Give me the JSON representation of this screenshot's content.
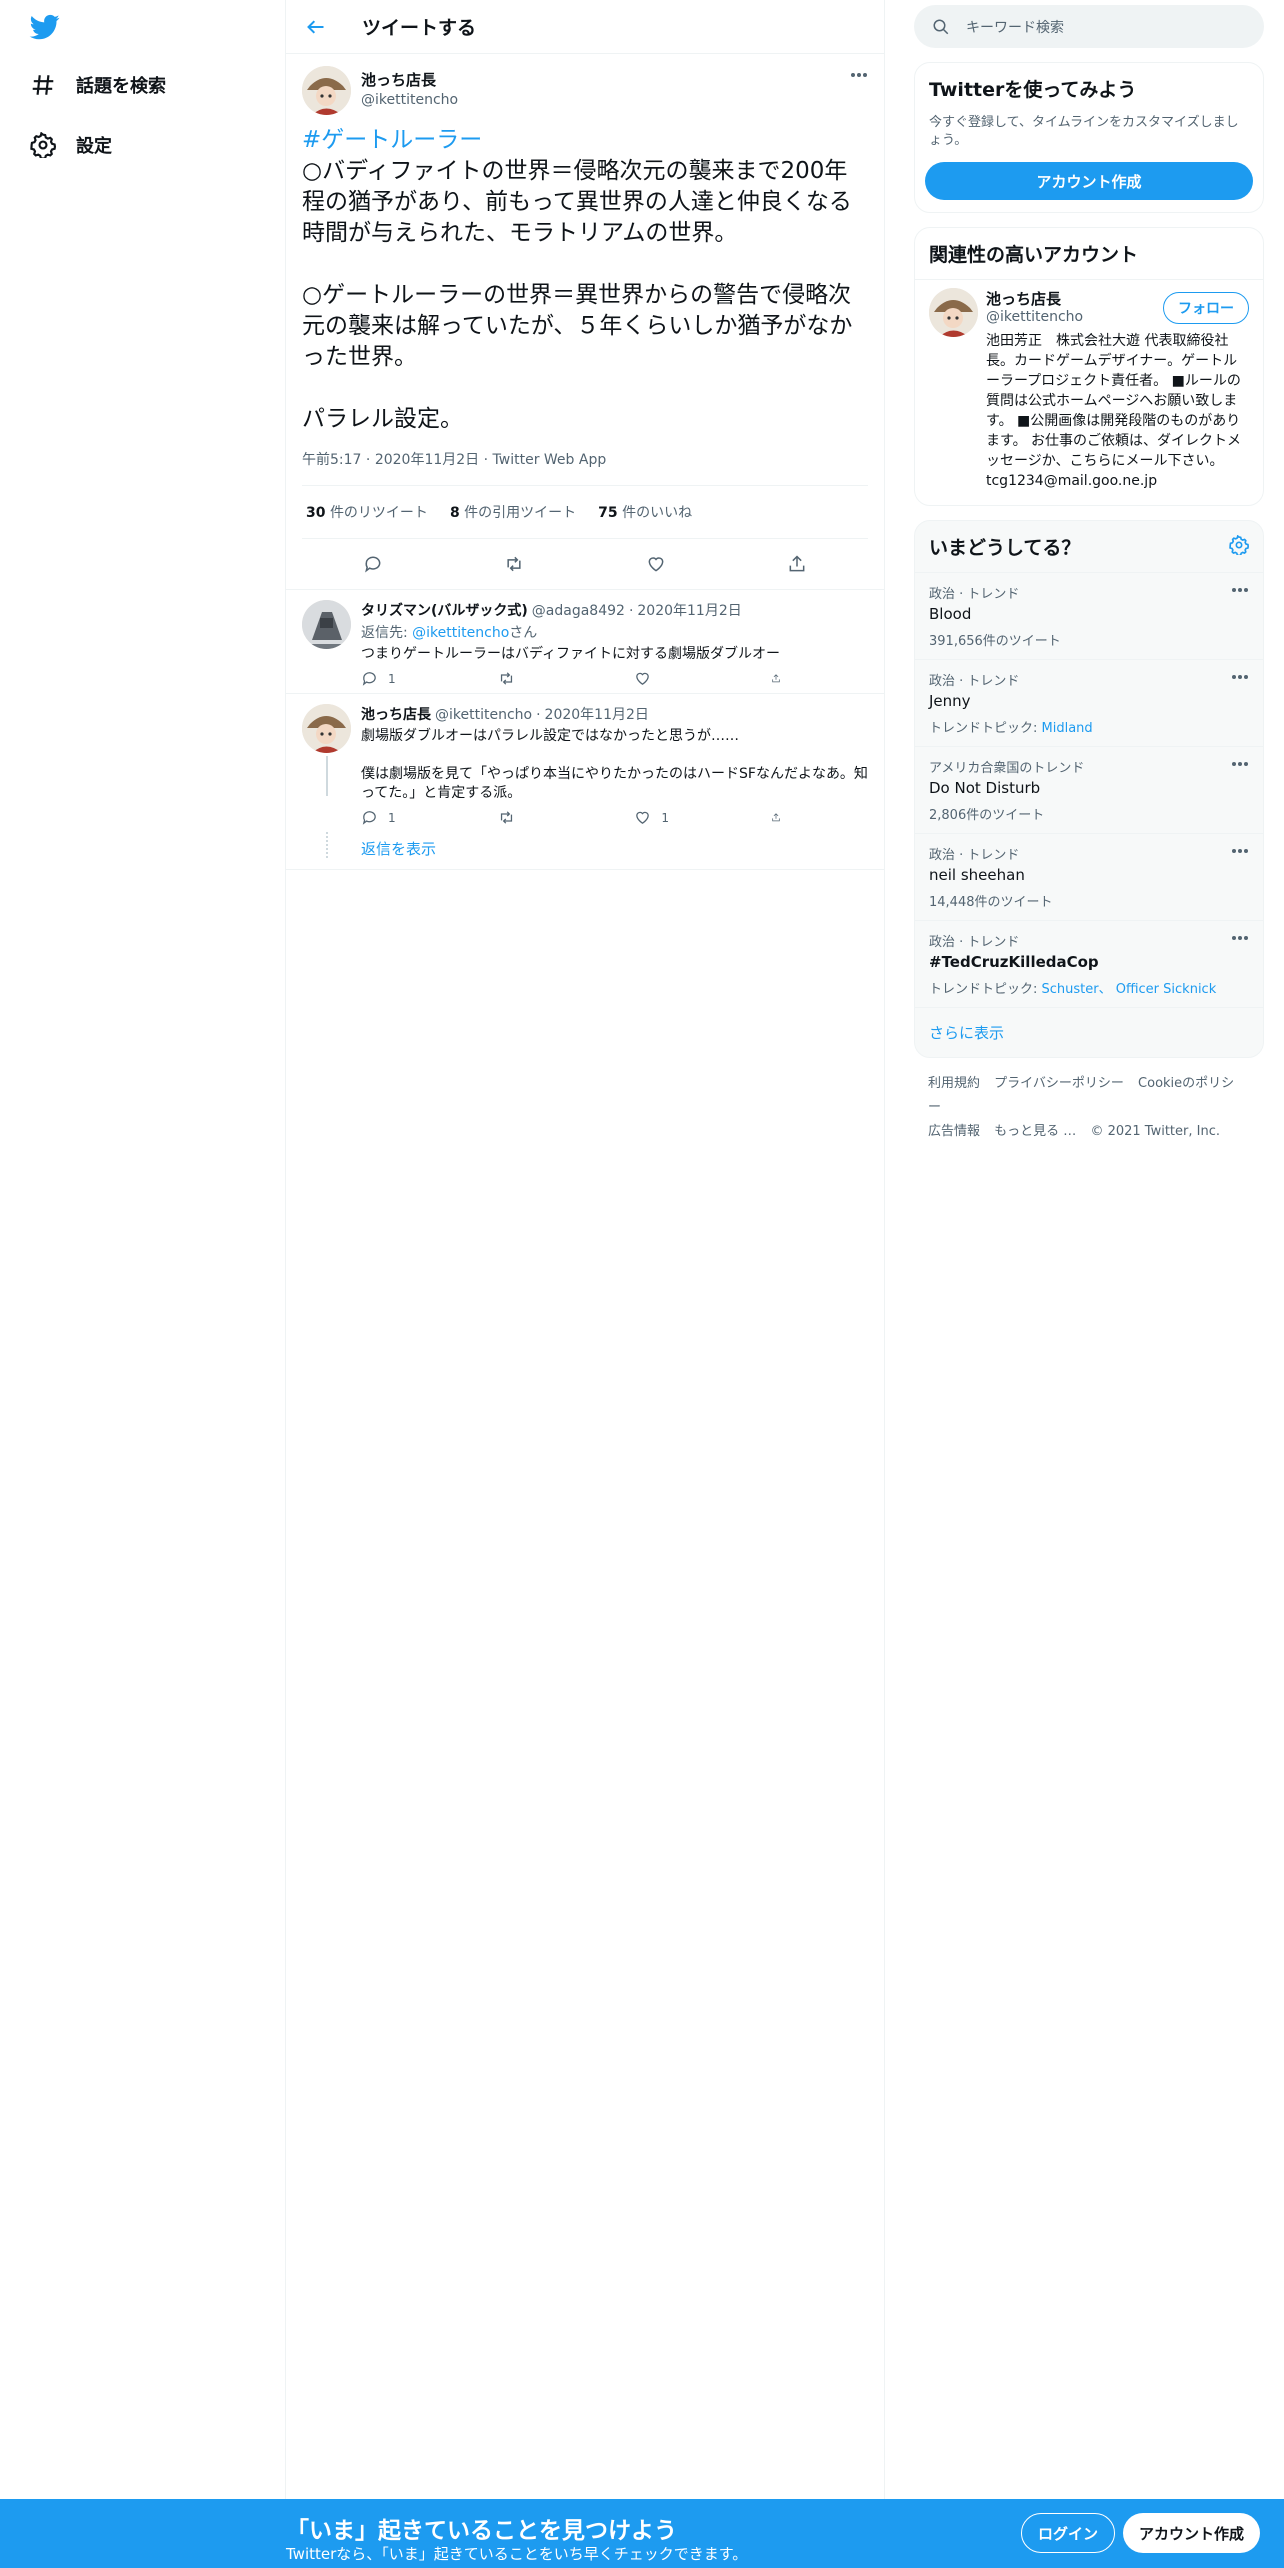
{
  "nav": {
    "items": [
      {
        "label": "話題を検索",
        "icon": "hashtag-icon"
      },
      {
        "label": "設定",
        "icon": "gear-icon"
      }
    ]
  },
  "header": {
    "title": "ツイートする"
  },
  "tweet": {
    "author": {
      "name": "池っち店長",
      "handle": "@ikettitencho"
    },
    "hashtag": "#ゲートルーラー",
    "body": "○バディファイトの世界＝侵略次元の襲来まで200年程の猶予があり、前もって異世界の人達と仲良くなる時間が与えられた、モラトリアムの世界。\n\n○ゲートルーラーの世界＝異世界からの警告で侵略次元の襲来は解っていたが、５年くらいしか猶予がなかった世界。\n\nパラレル設定。",
    "time": "午前5:17",
    "date": "2020年11月2日",
    "source": "Twitter Web App",
    "stats": [
      {
        "count": "30",
        "label": "件のリツイート"
      },
      {
        "count": "8",
        "label": "件の引用ツイート"
      },
      {
        "count": "75",
        "label": "件のいいね"
      }
    ]
  },
  "replies": [
    {
      "name": "タリズマン(バルザック式)",
      "handle": "@adaga8492",
      "date": "2020年11月2日",
      "replying_prefix": "返信先: ",
      "replying_mention": "@ikettitencho",
      "replying_suffix": "さん",
      "text": "つまりゲートルーラーはバディファイトに対する劇場版ダブルオー",
      "reply_count": "1",
      "like_count": ""
    },
    {
      "name": "池っち店長",
      "handle": "@ikettitencho",
      "date": "2020年11月2日",
      "text": "劇場版ダブルオーはパラレル設定ではなかったと思うが……\n\n僕は劇場版を見て「やっぱり本当にやりたかったのはハードSFなんだよなあ。知ってた。」と肯定する派。",
      "reply_count": "1",
      "like_count": "1"
    }
  ],
  "show_replies": "返信を表示",
  "sidebar": {
    "search_placeholder": "キーワード検索",
    "signup": {
      "title": "Twitterを使ってみよう",
      "sub": "今すぐ登録して、タイムラインをカスタマイズしましょう。",
      "button": "アカウント作成"
    },
    "related": {
      "title": "関連性の高いアカウント",
      "name": "池っち店長",
      "handle": "@ikettitencho",
      "follow": "フォロー",
      "bio": "池田芳正　株式会社大遊 代表取締役社長。カードゲームデザイナー。ゲートルーラープロジェクト責任者。 ■ルールの質問は公式ホームページへお願い致します。 ■公開画像は開発段階のものがあります。 お仕事のご依頼は、ダイレクトメッセージか、こちらにメール下さい。 tcg1234@mail.goo.ne.jp"
    },
    "trends": {
      "title": "いまどうしてる？",
      "items": [
        {
          "context": "政治 · トレンド",
          "name": "Blood",
          "sub": "391,656件のツイート"
        },
        {
          "context": "政治 · トレンド",
          "name": "Jenny",
          "sub_prefix": "トレンドトピック: ",
          "sub_links": "Midland"
        },
        {
          "context": "アメリカ合衆国のトレンド",
          "name": "Do Not Disturb",
          "sub": "2,806件のツイート"
        },
        {
          "context": "政治 · トレンド",
          "name": "neil sheehan",
          "sub": "14,448件のツイート"
        },
        {
          "context": "政治 · トレンド",
          "name": "#TedCruzKilledaCop",
          "sub_prefix": "トレンドトピック: ",
          "sub_links": "Schuster、 Officer Sicknick"
        }
      ],
      "show_more": "さらに表示"
    },
    "footer": {
      "links": [
        "利用規約",
        "プライバシーポリシー",
        "Cookieのポリシー",
        "広告情報",
        "もっと見る …",
        "© 2021 Twitter, Inc."
      ]
    }
  },
  "bottom_bar": {
    "title": "「いま」起きていることを見つけよう",
    "sub": "Twitterなら、「いま」起きていることをいち早くチェックできます。",
    "login": "ログイン",
    "signup": "アカウント作成"
  },
  "colors": {
    "accent": "#1d9bf0",
    "text": "#0f1419",
    "muted": "#536471",
    "border": "#eff3f4"
  }
}
